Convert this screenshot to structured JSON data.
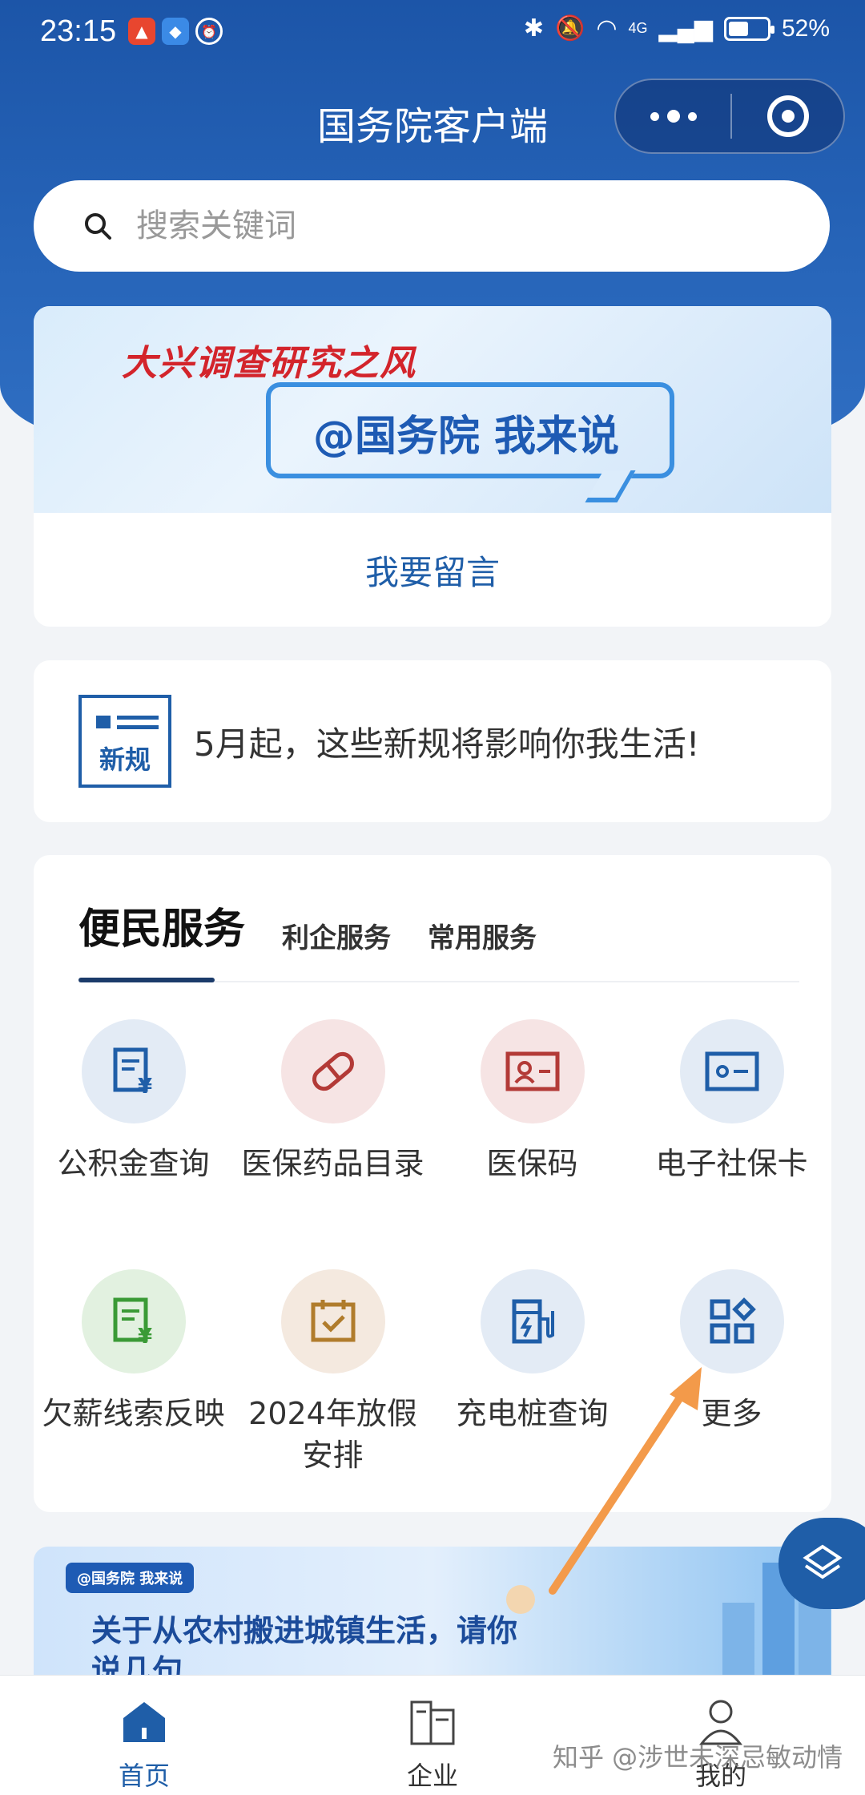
{
  "status_bar": {
    "time": "23:15",
    "network": "4G",
    "battery_percent": "52%",
    "battery_level": 0.52
  },
  "header": {
    "title": "国务院客户端"
  },
  "search": {
    "placeholder": "搜索关键词"
  },
  "banner": {
    "slogan": "大兴调查研究之风",
    "headline": "@国务院 我来说",
    "link_label": "我要留言"
  },
  "news": {
    "icon_label": "新规",
    "text": "5月起，这些新规将影响你我生活!"
  },
  "services": {
    "tabs": [
      {
        "label": "便民服务",
        "active": true
      },
      {
        "label": "利企服务",
        "active": false
      },
      {
        "label": "常用服务",
        "active": false
      }
    ],
    "items": [
      {
        "label": "公积金查询",
        "icon": "fund-document-icon",
        "bg": "#e3ebf5",
        "color": "#1f5ea8"
      },
      {
        "label": "医保药品目录",
        "icon": "pill-icon",
        "bg": "#f6e4e4",
        "color": "#b33a37"
      },
      {
        "label": "医保码",
        "icon": "id-card-icon",
        "bg": "#f6e4e4",
        "color": "#b33a37"
      },
      {
        "label": "电子社保卡",
        "icon": "social-card-icon",
        "bg": "#e3ebf5",
        "color": "#1f5ea8"
      },
      {
        "label": "欠薪线索反映",
        "icon": "wage-document-icon",
        "bg": "#e2f1e0",
        "color": "#3a9a36"
      },
      {
        "label": "2024年放假安排",
        "icon": "calendar-check-icon",
        "bg": "#f4e9df",
        "color": "#b07c2c"
      },
      {
        "label": "充电桩查询",
        "icon": "charging-pile-icon",
        "bg": "#e3ebf5",
        "color": "#1f5ea8"
      },
      {
        "label": "更多",
        "icon": "grid-more-icon",
        "bg": "#e3ebf5",
        "color": "#1f5ea8"
      }
    ]
  },
  "promo": {
    "tag": "@国务院 我来说",
    "title": "关于从农村搬进城镇生活，请你说几句"
  },
  "bottom_nav": [
    {
      "label": "首页",
      "icon": "home-icon",
      "active": true
    },
    {
      "label": "企业",
      "icon": "enterprise-icon",
      "active": false
    },
    {
      "label": "我的",
      "icon": "profile-icon",
      "active": false
    }
  ],
  "watermark": "知乎 @涉世未深忌敏动情",
  "colors": {
    "brand_blue": "#1f5ea8",
    "header_blue": "#1c55a8",
    "annotation_arrow": "#f39a4a"
  }
}
